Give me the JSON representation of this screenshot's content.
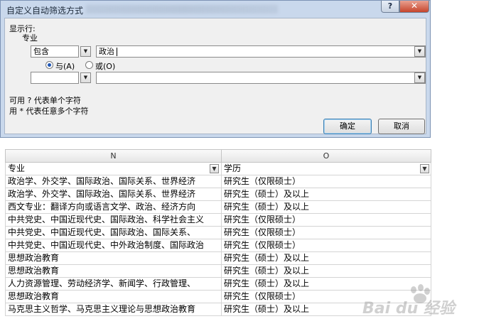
{
  "dialog": {
    "title": "自定义自动筛选方式",
    "help_label": "?",
    "close_label": "✕",
    "show_rows_label": "显示行:",
    "field_label": "专业",
    "condition1": {
      "operator": "包含",
      "value": "政治"
    },
    "logic": {
      "and_label": "与(A)",
      "or_label": "或(O)",
      "selected": "and"
    },
    "condition2": {
      "operator": "",
      "value": ""
    },
    "hint_line1": "可用 ? 代表单个字符",
    "hint_line2": "用 * 代表任意多个字符",
    "ok_label": "确定",
    "cancel_label": "取消"
  },
  "sheet": {
    "column_letters": [
      "N",
      "O"
    ],
    "headers": [
      "专业",
      "学历"
    ],
    "rows": [
      [
        "政治学、外交学、国际政治、国际关系、世界经济",
        "研究生（仅限硕士）"
      ],
      [
        "政治学、外交学、国际政治、国际关系、世界经济",
        "研究生（硕士）及以上"
      ],
      [
        "西文专业：翻译方向或语言文学、政治、经济方向",
        "研究生（硕士）及以上"
      ],
      [
        "中共党史、中国近现代史、国际政治、科学社会主义",
        "研究生（仅限硕士）"
      ],
      [
        "中共党史、中国近现代史、国际政治、国际关系、",
        "研究生（仅限硕士）"
      ],
      [
        "中共党史、中国近现代史、中外政治制度、国际政治",
        "研究生（仅限硕士）"
      ],
      [
        "思想政治教育",
        "研究生（硕士）及以上"
      ],
      [
        "思想政治教育",
        "研究生（硕士）及以上"
      ],
      [
        "人力资源管理、劳动经济学、新闻学、行政管理、",
        "研究生（硕士）及以上"
      ],
      [
        "思想政治教育",
        "研究生（仅限硕士）"
      ],
      [
        "马克思主义哲学、马克思主义理论与思想政治教育",
        "研究生（硕士）及以上"
      ]
    ]
  },
  "watermark": {
    "text": "Bai du 经验"
  }
}
